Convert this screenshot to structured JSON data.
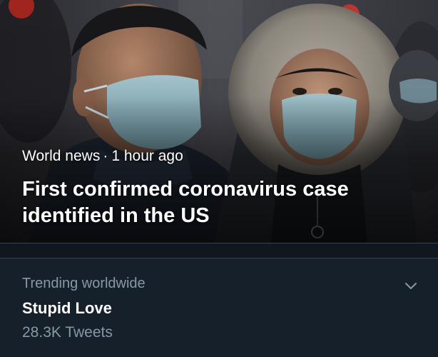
{
  "news_card": {
    "category": "World news",
    "separator": "·",
    "time_ago": "1 hour ago",
    "headline": "First confirmed coronavirus case identified in the US",
    "image_icon": "news-photo-two-people-wearing-surgical-masks"
  },
  "trending": {
    "context": "Trending worldwide",
    "topic": "Stupid Love",
    "tweet_count": "28.3K Tweets",
    "menu_icon": "chevron-down-icon"
  },
  "colors": {
    "background": "#15202b",
    "divider": "#10171e",
    "border": "#38444d",
    "secondary_text": "#8899a6",
    "primary_text": "#ffffff"
  }
}
